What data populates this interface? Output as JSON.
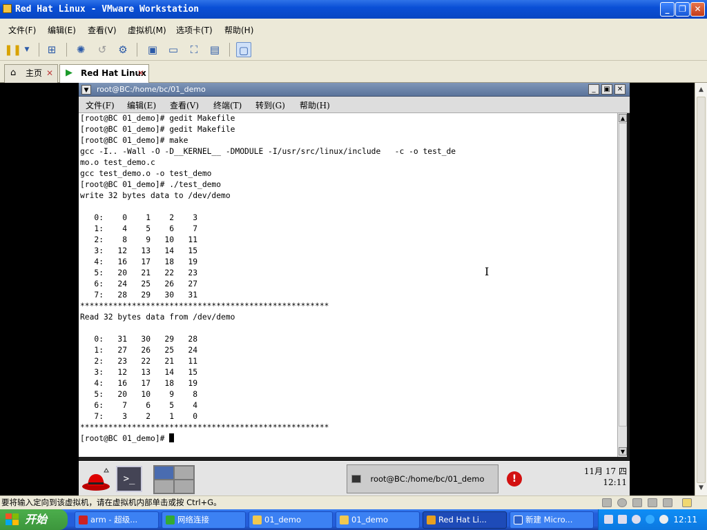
{
  "window": {
    "title": "Red Hat Linux - VMware Workstation"
  },
  "vm_menu": [
    "文件(F)",
    "编辑(E)",
    "查看(V)",
    "虚拟机(M)",
    "选项卡(T)",
    "帮助(H)"
  ],
  "tabs": [
    {
      "label": "主页"
    },
    {
      "label": "Red Hat Linux"
    }
  ],
  "terminal": {
    "title": "root@BC:/home/bc/01_demo",
    "menu": [
      "文件(F)",
      "编辑(E)",
      "查看(V)",
      "终端(T)",
      "转到(G)",
      "帮助(H)"
    ],
    "lines": [
      "[root@BC 01_demo]# gedit Makefile",
      "[root@BC 01_demo]# gedit Makefile",
      "[root@BC 01_demo]# make",
      "gcc -I.. -Wall -O -D__KERNEL__ -DMODULE -I/usr/src/linux/include   -c -o test_de",
      "mo.o test_demo.c",
      "gcc test_demo.o -o test_demo",
      "[root@BC 01_demo]# ./test_demo",
      "write 32 bytes data to /dev/demo",
      "",
      "   0:    0    1    2    3",
      "   1:    4    5    6    7",
      "   2:    8    9   10   11",
      "   3:   12   13   14   15",
      "   4:   16   17   18   19",
      "   5:   20   21   22   23",
      "   6:   24   25   26   27",
      "   7:   28   29   30   31",
      "*****************************************************",
      "Read 32 bytes data from /dev/demo",
      "",
      "   0:   31   30   29   28",
      "   1:   27   26   25   24",
      "   2:   23   22   21   11",
      "   3:   12   13   14   15",
      "   4:   16   17   18   19",
      "   5:   20   10    9    8",
      "   6:    7    6    5    4",
      "   7:    3    2    1    0",
      "*****************************************************"
    ],
    "prompt": "[root@BC 01_demo]# "
  },
  "panel": {
    "task_label": "root@BC:/home/bc/01_demo",
    "clock_date": "11月 17 四",
    "clock_time": "12:11"
  },
  "status_text": "要将输入定向到该虚拟机，请在虚拟机内部单击或按 Ctrl+G。",
  "taskbar": {
    "start": "开始",
    "tasks": [
      "arm - 超级...",
      "网络连接",
      "01_demo",
      "01_demo",
      "Red Hat Li...",
      "新建 Micro..."
    ],
    "clock": "12:11"
  },
  "colors": {
    "title_bar": "#0a4fd6",
    "taskbar": "#245edb",
    "start": "#3c963c",
    "terminal_bg": "#ffffff"
  }
}
